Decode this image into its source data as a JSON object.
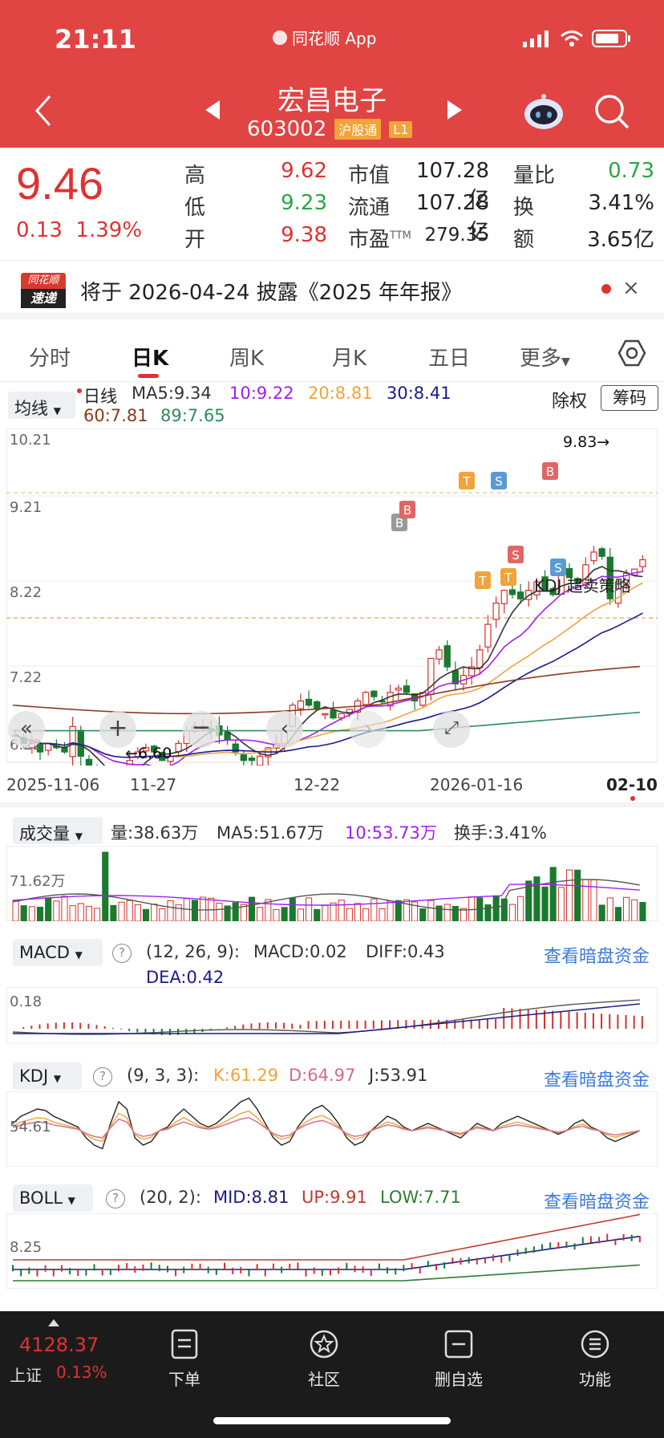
{
  "status_bar": {
    "time": "21:11",
    "app": "同花顺 App"
  },
  "header": {
    "title": "宏昌电子",
    "code": "603002",
    "tag_hgt": "沪股通",
    "tag_level": "L1"
  },
  "quote": {
    "price": "9.46",
    "change": "0.13",
    "change_pct": "1.39%",
    "high_label": "高",
    "high": "9.62",
    "low_label": "低",
    "low": "9.23",
    "open_label": "开",
    "open": "9.38",
    "mktcap_label": "市值",
    "mktcap": "107.28亿",
    "float_label": "流通",
    "float": "107.28亿",
    "pe_label": "市盈",
    "pe_sup": "TTM",
    "pe": "279.35",
    "vol_ratio_label": "量比",
    "vol_ratio": "0.73",
    "turnover_label": "换",
    "turnover": "3.41%",
    "amount_label": "额",
    "amount": "3.65亿"
  },
  "notice": {
    "logo_top": "同花顺",
    "logo_bottom": "速递",
    "text": "将于 2026-04-24 披露《2025 年年报》",
    "close": "×"
  },
  "tabs": [
    "分时",
    "日K",
    "周K",
    "月K",
    "五日",
    "更多"
  ],
  "kline": {
    "selector": "均线",
    "line_type": "日线",
    "ma5": "MA5:9.34",
    "ma10": "10:9.22",
    "ma20": "20:8.81",
    "ma30": "30:8.41",
    "ma60": "60:7.81",
    "ma89": "89:7.65",
    "exright": "除权",
    "chips": "筹码",
    "y_top": "10.21",
    "y_2": "9.21",
    "y_3": "8.22",
    "y_4": "7.22",
    "y_bottom": "6.22",
    "max_label": "9.83→",
    "min_label": "←6.60",
    "strategy_label": "KDJ 超卖策略",
    "dates": [
      "2025-11-06",
      "11-27",
      "12-22",
      "2026-01-16",
      "02-10"
    ],
    "signals": [
      "T",
      "S",
      "B",
      "B",
      "B",
      "T",
      "T",
      "S",
      "S"
    ]
  },
  "volume": {
    "selector": "成交量",
    "vol": "量:38.63万",
    "ma5": "MA5:51.67万",
    "ma10": "10:53.73万",
    "turnover": "换手:3.41%",
    "y_label": "71.62万"
  },
  "macd": {
    "selector": "MACD",
    "params": "(12, 26, 9):",
    "macd": "MACD:0.02",
    "diff": "DIFF:0.43",
    "dea": "DEA:0.42",
    "y_label": "0.18",
    "link": "查看暗盘资金"
  },
  "kdj": {
    "selector": "KDJ",
    "params": "(9, 3, 3):",
    "k": "K:61.29",
    "d": "D:64.97",
    "j": "J:53.91",
    "y_label": "54.61",
    "link": "查看暗盘资金"
  },
  "boll": {
    "selector": "BOLL",
    "params": "(20, 2):",
    "mid": "MID:8.81",
    "up": "UP:9.91",
    "low": "LOW:7.71",
    "y_label": "8.25",
    "link": "查看暗盘资金"
  },
  "bottom_nav": {
    "index_value": "4128.37",
    "index_name": "上证",
    "index_pct": "0.13%",
    "items": [
      "下单",
      "社区",
      "删自选",
      "功能"
    ]
  },
  "colors": {
    "header_red": "#e04443",
    "up": "#e03131",
    "down": "#1a7a2e",
    "ma5": "#333333",
    "ma10": "#a020f0",
    "ma20": "#f2a33a",
    "ma30": "#1a1a8c",
    "ma60": "#8b3a1a",
    "ma89": "#2e8b57"
  }
}
